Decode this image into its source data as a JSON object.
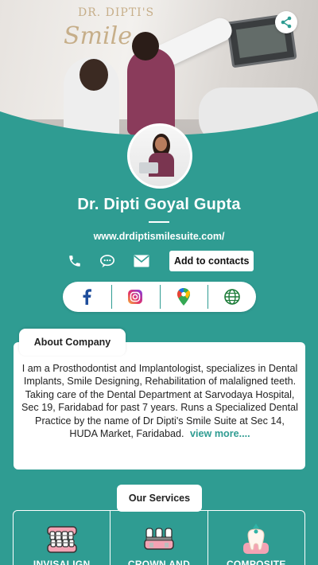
{
  "profile": {
    "name": "Dr. Dipti Goyal Gupta",
    "website": "www.drdiptismilesuite.com/",
    "add_contacts_label": "Add to contacts"
  },
  "header": {
    "sign_line1": "DR. DIPTI'S",
    "sign_line2": "Smile"
  },
  "contact_icons": [
    "phone-icon",
    "chat-icon",
    "email-icon"
  ],
  "social_links": [
    "facebook-icon",
    "instagram-icon",
    "google-maps-icon",
    "website-globe-icon"
  ],
  "about": {
    "title": "About Company",
    "text": "I am a Prosthodontist and Implantologist, specializes in Dental Implants, Smile Designing, Rehabilitation of malaligned teeth. Taking care of the Dental Department at Sarvodaya Hospital, Sec 19, Faridabad for past 7 years. Runs a Specialized Dental Practice by the name of Dr Dipti's Smile Suite at Sec 14, HUDA Market, Faridabad.",
    "more_label": "view more...."
  },
  "services": {
    "title": "Our Services",
    "items": [
      {
        "label": "INVISALIGN",
        "icon": "braces-teeth-icon"
      },
      {
        "label": "CROWN AND",
        "icon": "crown-bridge-icon"
      },
      {
        "label": "COMPOSITE",
        "icon": "tooth-filling-icon"
      }
    ]
  },
  "colors": {
    "primary": "#2f9c92",
    "card": "#ffffff",
    "text": "#222222"
  }
}
